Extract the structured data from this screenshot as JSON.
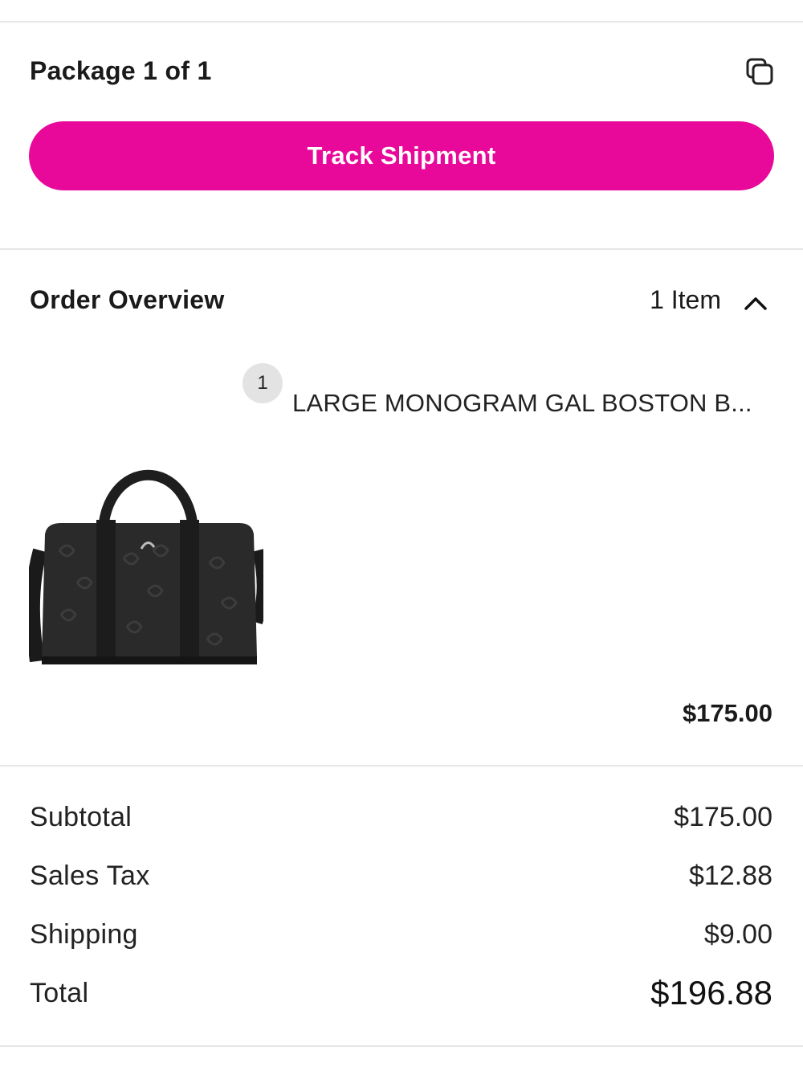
{
  "package": {
    "title": "Package 1 of 1",
    "track_button_label": "Track Shipment",
    "accent_color": "#e8099a"
  },
  "order_overview": {
    "title": "Order Overview",
    "item_count": "1 Item",
    "toggle_icon": "chevron-up-icon",
    "items": [
      {
        "quantity": "1",
        "name": "LARGE MONOGRAM GAL BOSTON B...",
        "price": "$175.00",
        "image": "black monogram leather boston bag"
      }
    ]
  },
  "summary": {
    "subtotal_label": "Subtotal",
    "subtotal_value": "$175.00",
    "tax_label": "Sales Tax",
    "tax_value": "$12.88",
    "shipping_label": "Shipping",
    "shipping_value": "$9.00",
    "total_label": "Total",
    "total_value": "$196.88"
  }
}
